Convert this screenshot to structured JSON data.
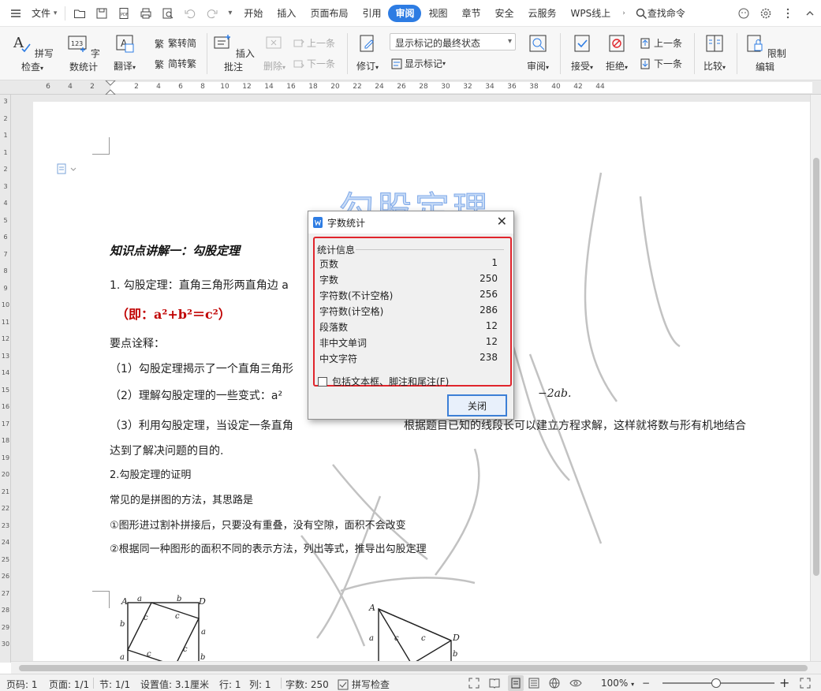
{
  "titlebar": {
    "file_menu": "文件",
    "tabs": [
      "开始",
      "插入",
      "页面布局",
      "引用",
      "审阅",
      "视图",
      "章节",
      "安全",
      "云服务",
      "WPS线上"
    ],
    "active_tab": "审阅",
    "search_label": "查找命令"
  },
  "ribbon": {
    "spell_check": "拼写检查",
    "word_count": "字数统计",
    "translate": "翻译",
    "trad_to_simp": "繁转简",
    "simp_to_trad": "简转繁",
    "insert_comment": "插入批注",
    "delete": "删除",
    "prev": "上一条",
    "next": "下一条",
    "revise": "修订",
    "show_markup": "显示标记",
    "display_state": "显示标记的最终状态",
    "review": "审阅",
    "accept": "接受",
    "reject": "拒绝",
    "change_prev": "上一条",
    "change_next": "下一条",
    "compare": "比较",
    "restrict_edit": "限制编辑"
  },
  "ruler": {
    "h_numbers": [
      "6",
      "4",
      "2",
      "2",
      "4",
      "6",
      "8",
      "10",
      "12",
      "14",
      "16",
      "18",
      "20",
      "22",
      "24",
      "26",
      "28",
      "30",
      "32",
      "34",
      "36",
      "38",
      "40",
      "42",
      "44"
    ],
    "v_numbers": [
      "3",
      "2",
      "1",
      "1",
      "2",
      "3",
      "4",
      "5",
      "6",
      "7",
      "8",
      "9",
      "10",
      "11",
      "12",
      "13",
      "14",
      "15",
      "16",
      "17",
      "18",
      "19",
      "20",
      "21",
      "22",
      "23",
      "24",
      "25",
      "26",
      "27",
      "28",
      "29",
      "30"
    ]
  },
  "document": {
    "title": "勾股定理",
    "heading": "知识点讲解一：勾股定理",
    "p1": "1. 勾股定理：直角三角形两直角边 a",
    "formula": "（即：a²+b²＝c²）",
    "p2": "要点诠释：",
    "p3": "（1）勾股定理揭示了一个直角三角形",
    "p4_left": "（2）理解勾股定理的一些变式：a²",
    "p4_right": "−2ab.",
    "p5_left": "（3）利用勾股定理，当设定一条直角",
    "p5_right": "根据题目已知的线段长可以建立方程求解，这样就将数与形有机地结合",
    "p6": "达到了解决问题的目的.",
    "p7": "2.勾股定理的证明",
    "p8": "常见的是拼图的方法，其思路是",
    "p9": "①图形进过割补拼接后，只要没有重叠，没有空隙，面积不会改变",
    "p10": "②根据同一种图形的面积不同的表示方法，列出等式，推导出勾股定理",
    "watermark": "严 禁 复 制"
  },
  "dialog": {
    "title": "字数统计",
    "group_label": "统计信息",
    "stats": [
      {
        "label": "页数",
        "value": "1"
      },
      {
        "label": "字数",
        "value": "250"
      },
      {
        "label": "字符数(不计空格)",
        "value": "256"
      },
      {
        "label": "字符数(计空格)",
        "value": "286"
      },
      {
        "label": "段落数",
        "value": "12"
      },
      {
        "label": "非中文单词",
        "value": "12"
      },
      {
        "label": "中文字符",
        "value": "238"
      }
    ],
    "checkbox_label": "包括文本框、脚注和尾注(F)",
    "close_button": "关闭"
  },
  "status": {
    "page_num": "页码: 1",
    "pages": "页面: 1/1",
    "section": "节: 1/1",
    "setting": "设置值: 3.1厘米",
    "row": "行: 1",
    "col": "列: 1",
    "words": "字数: 250",
    "spell": "拼写检查",
    "zoom": "100%"
  },
  "colors": {
    "accent": "#2d7ce3",
    "highlight_border": "#e0252c",
    "formula_red": "#c00000"
  }
}
